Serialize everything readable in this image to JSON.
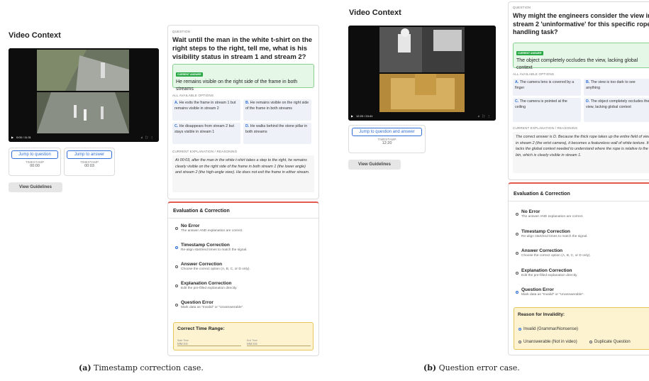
{
  "panel_a": {
    "video_context_title": "Video Context",
    "video_time": "0:00 / 11:31",
    "jump_question_label": "Jump to question",
    "jump_answer_label": "Jump to answer",
    "timestamp_label": "TIMESTAMP",
    "question_timestamp": "00:00",
    "answer_timestamp": "00:03",
    "guidelines_label": "View Guidelines",
    "question_header": "QUESTION",
    "question": "Wait until the man in the white t-shirt on the right steps to the right, tell me, what is his visibility status in stream 1 and stream 2?",
    "current_answer_badge": "CURRENT ANSWER",
    "current_answer": "He remains visible on the right side of the frame in both streams",
    "options_header": "ALL AVAILABLE OPTIONS",
    "options": [
      {
        "letter": "A.",
        "text": "He exits the frame in stream 1 but remains visible in stream 2"
      },
      {
        "letter": "B.",
        "text": "He remains visible on the right side of the frame in both streams"
      },
      {
        "letter": "C.",
        "text": "He disappears from stream 2 but stays visible in stream 1"
      },
      {
        "letter": "D.",
        "text": "He walks behind the stone pillar in both streams"
      }
    ],
    "explanation_header": "CURRENT EXPLANATION / REASONING",
    "explanation": "At 00:03, after the man in the white t-shirt takes a step to the right, he remains clearly visible on the right side of the frame in both stream 1 (the lower angle) and stream 2 (the high-angle view). He does not exit the frame in either stream.",
    "eval_title": "Evaluation & Correction",
    "eval_options": [
      {
        "title": "No Error",
        "sub": "The answer AND explanation are correct."
      },
      {
        "title": "Timestamp Correction",
        "sub": "Re-align start/end times to match the signal."
      },
      {
        "title": "Answer Correction",
        "sub": "Choose the correct option (A, B, C, or D only)."
      },
      {
        "title": "Explanation Correction",
        "sub": "Edit the pre-filled explanation directly."
      },
      {
        "title": "Question Error",
        "sub": "Mark data as \"Invalid\" or \"Unanswerable\"."
      }
    ],
    "selected_eval": "Timestamp Correction",
    "correct_time_title": "Correct Time Range:",
    "start_time_label": "Start Time",
    "start_time_placeholder": "MM:SS",
    "end_time_label": "End Time",
    "end_time_placeholder": "MM:SS"
  },
  "panel_b": {
    "video_context_title": "Video Context",
    "video_time": "12:20 / 24:41",
    "jump_label": "Jump to question and answer",
    "timestamp_label": "TIMESTAMP",
    "timestamp": "12:20",
    "guidelines_label": "View Guidelines",
    "question_header": "QUESTION",
    "question": "Why might the engineers consider the view in stream 2 'uninformative' for this specific rope-handling task?",
    "current_answer_badge": "CURRENT ANSWER",
    "current_answer": "The object completely occludes the view, lacking global context",
    "options_header": "ALL AVAILABLE OPTIONS",
    "options": [
      {
        "letter": "A.",
        "text": "The camera lens is covered by a finger"
      },
      {
        "letter": "B.",
        "text": "The view is too dark to see anything"
      },
      {
        "letter": "C.",
        "text": "The camera is pointed at the ceiling"
      },
      {
        "letter": "D.",
        "text": "The object completely occludes the view, lacking global context"
      }
    ],
    "explanation_header": "CURRENT EXPLANATION / REASONING",
    "explanation": "The correct answer is D. Because the thick rope takes up the entire field of view in stream 2 (the wrist camera), it becomes a featureless wall of white texture. It lacks the global context needed to understand where the rope is relative to the bin, which is clearly visible in stream 1.",
    "eval_title": "Evaluation & Correction",
    "eval_options": [
      {
        "title": "No Error",
        "sub": "The answer AND explanation are correct."
      },
      {
        "title": "Timestamp Correction",
        "sub": "Re-align start/end times to match the signal."
      },
      {
        "title": "Answer Correction",
        "sub": "Choose the correct option (A, B, C, or D only)."
      },
      {
        "title": "Explanation Correction",
        "sub": "Edit the pre-filled explanation directly."
      },
      {
        "title": "Question Error",
        "sub": "Mark data as \"Invalid\" or \"Unanswerable\"."
      }
    ],
    "selected_eval": "Question Error",
    "invalidity_title": "Reason for Invalidity:",
    "invalid_option": "Invalid (Grammar/Nonsense)",
    "unanswerable_option": "Unanswerable (Not in video)",
    "duplicate_option": "Duplicate Question"
  },
  "captions": {
    "a_label": "(a)",
    "a_text": "Timestamp correction case.",
    "b_label": "(b)",
    "b_text": "Question error case."
  },
  "colors": {
    "accent_blue": "#2f6fd6",
    "answer_green": "#28a745",
    "eval_border": "#e05a4f",
    "warning_yellow": "#fdf3d0"
  }
}
